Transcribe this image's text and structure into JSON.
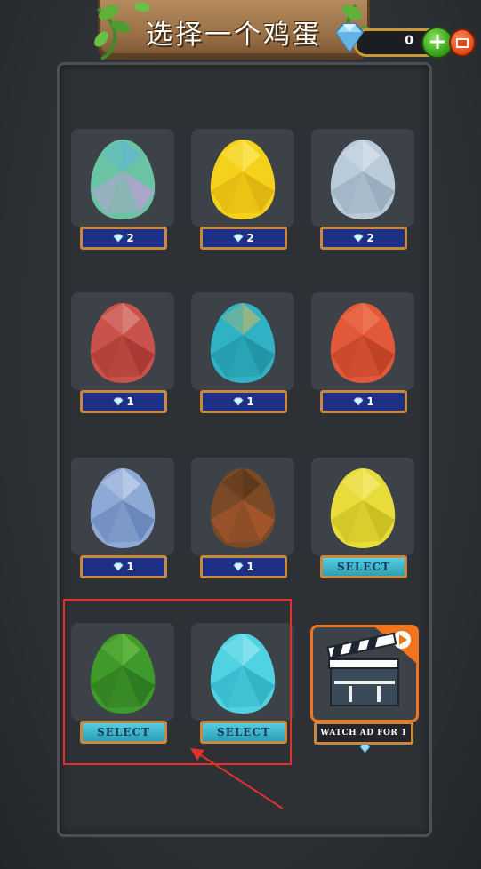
{
  "header": {
    "title": "选择一个鸡蛋",
    "gem_count": "0"
  },
  "colors": {
    "panel_bg": "#2d3135",
    "price_bg": "#1e2f86",
    "select_bg": "#3bb6cc",
    "highlight": "#e3312a",
    "ad_border": "#f0751e"
  },
  "eggs": [
    {
      "name": "rainbow-glitter-egg",
      "colors": [
        "#6ac4a4",
        "#c39bd8",
        "#5ab3e3"
      ],
      "action": "price",
      "price": "2"
    },
    {
      "name": "gold-egg",
      "colors": [
        "#f4d21c",
        "#d8a80a",
        "#fff07a"
      ],
      "action": "price",
      "price": "2"
    },
    {
      "name": "silver-egg",
      "colors": [
        "#b9cad8",
        "#8ea3b7",
        "#e4ecf2"
      ],
      "action": "price",
      "price": "2"
    },
    {
      "name": "red-marble-egg",
      "colors": [
        "#c9524a",
        "#9b2f2a",
        "#e3a09a"
      ],
      "action": "price",
      "price": "1"
    },
    {
      "name": "teal-spotted-egg",
      "colors": [
        "#2fb2c4",
        "#1c8a9b",
        "#e0b85a"
      ],
      "action": "price",
      "price": "1"
    },
    {
      "name": "orange-egg",
      "colors": [
        "#e2583a",
        "#b33a20",
        "#f28a62"
      ],
      "action": "price",
      "price": "1"
    },
    {
      "name": "blue-ice-egg",
      "colors": [
        "#8ea9d6",
        "#5c7ab0",
        "#d6e2f4"
      ],
      "action": "price",
      "price": "1"
    },
    {
      "name": "brown-egg",
      "colors": [
        "#7a4a26",
        "#b45a2e",
        "#4a2c14"
      ],
      "action": "price",
      "price": "1"
    },
    {
      "name": "yellow-egg",
      "colors": [
        "#e8dc3a",
        "#c2b21a",
        "#f6f08a"
      ],
      "action": "select",
      "select_label": "SELECT"
    },
    {
      "name": "green-egg",
      "colors": [
        "#3f9a2c",
        "#2a6e1c",
        "#7ecb50"
      ],
      "action": "select",
      "select_label": "SELECT"
    },
    {
      "name": "cyan-egg",
      "colors": [
        "#4fd2e2",
        "#2aa8bb",
        "#a8eef6"
      ],
      "action": "select",
      "select_label": "SELECT"
    }
  ],
  "ad": {
    "label": "WATCH AD FOR 1",
    "icon": "clapperboard-icon"
  }
}
